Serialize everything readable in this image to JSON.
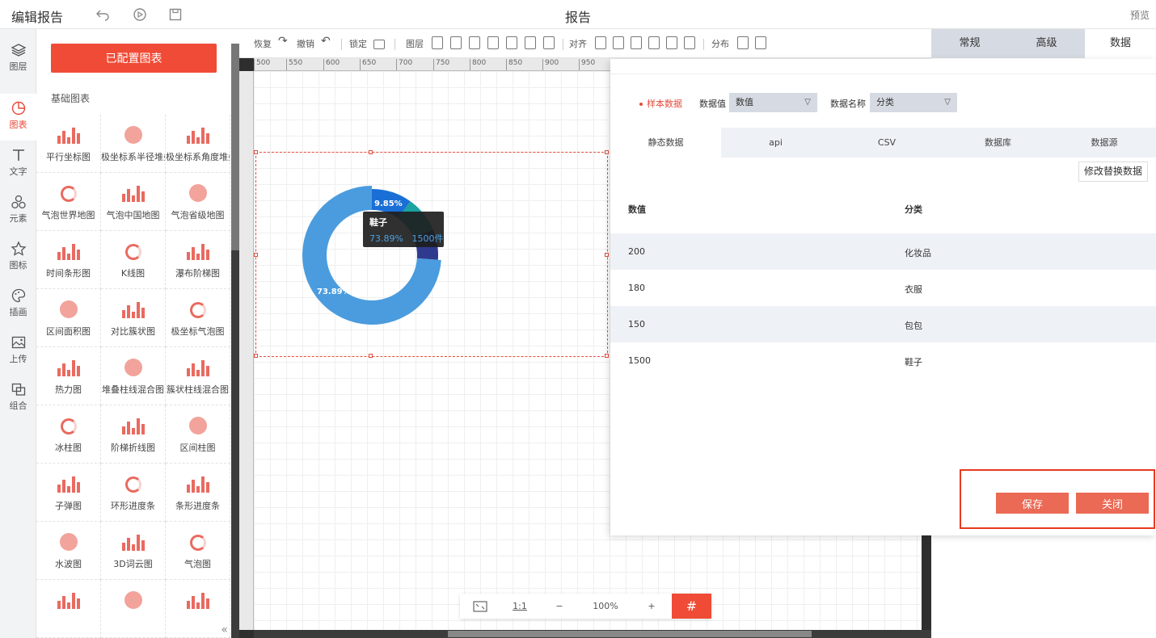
{
  "header": {
    "app_title": "编辑报告",
    "doc_title": "报告",
    "preview": "预览"
  },
  "leftnav": {
    "items": [
      {
        "label": "图层",
        "icon": "layers-icon"
      },
      {
        "label": "图表",
        "icon": "chart-pie-icon"
      },
      {
        "label": "文字",
        "icon": "text-icon"
      },
      {
        "label": "元素",
        "icon": "shapes-icon"
      },
      {
        "label": "图标",
        "icon": "star-icon"
      },
      {
        "label": "插画",
        "icon": "palette-icon"
      },
      {
        "label": "上传",
        "icon": "image-upload-icon"
      },
      {
        "label": "组合",
        "icon": "group-icon"
      }
    ]
  },
  "library": {
    "configured_button": "已配置图表",
    "section": "基础图表",
    "items": [
      "平行坐标图",
      "极坐标系半径堆叠图",
      "极坐标系角度堆叠图",
      "气泡世界地图",
      "气泡中国地图",
      "气泡省级地图",
      "时间条形图",
      "K线图",
      "瀑布阶梯图",
      "区间面积图",
      "对比簇状图",
      "极坐标气泡图",
      "热力图",
      "堆叠柱线混合图",
      "簇状柱线混合图",
      "冰柱图",
      "阶梯折线图",
      "区间柱图",
      "子弹图",
      "环形进度条",
      "条形进度条",
      "水波图",
      "3D词云图",
      "气泡图",
      "",
      "",
      ""
    ]
  },
  "toolbar": {
    "redo": "恢复",
    "undo": "撤销",
    "lock": "锁定",
    "layer": "图层",
    "align": "对齐",
    "distribute": "分布"
  },
  "ruler": {
    "ticks": [
      "500",
      "550",
      "600",
      "650",
      "700",
      "750",
      "800",
      "850",
      "900",
      "950"
    ]
  },
  "chart": {
    "label_large": "73.89%",
    "label_small": "9.85%",
    "tooltip_title": "鞋子",
    "tooltip_percent": "73.89%",
    "tooltip_value": "1500件"
  },
  "chart_data": {
    "type": "pie",
    "categories": [
      "化妆品",
      "衣服",
      "包包",
      "鞋子"
    ],
    "values": [
      200,
      180,
      150,
      1500
    ],
    "colors": [
      "#1a6fd6",
      "#1aa3a0",
      "#2f3a8f",
      "#4a9cde"
    ]
  },
  "zoom": {
    "ratio": "1:1",
    "minus": "−",
    "level": "100%",
    "plus": "+",
    "grid": "#"
  },
  "right_tabs": [
    "常规",
    "高级",
    "数据"
  ],
  "dialog": {
    "sample_label": "样本数据",
    "value_label": "数据值",
    "value_select": "数值",
    "name_label": "数据名称",
    "name_select": "分类",
    "tabs": [
      "静态数据",
      "api",
      "CSV",
      "数据库",
      "数据源"
    ],
    "modify_button": "修改替换数据",
    "columns": [
      "数值",
      "分类"
    ],
    "rows": [
      [
        "200",
        "化妆品"
      ],
      [
        "180",
        "衣服"
      ],
      [
        "150",
        "包包"
      ],
      [
        "1500",
        "鞋子"
      ]
    ],
    "save_button": "保存",
    "close_button": "关闭"
  },
  "colors": {
    "accent": "#f04b36",
    "dialog_button": "#ea6a55",
    "highlight_border": "#e8391f"
  }
}
